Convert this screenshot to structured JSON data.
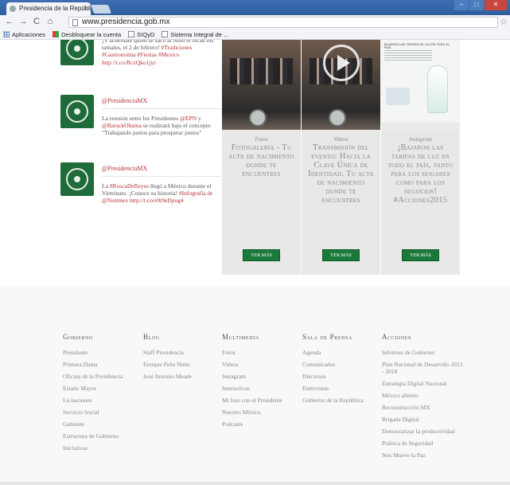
{
  "browser": {
    "tab_title": "Presidencia de la Repúblic",
    "tab_close": "×",
    "url": "www.presidencia.gob.mx",
    "bookmarks": [
      {
        "label": "Aplicaciones",
        "icon": "apps-grid-icon"
      },
      {
        "label": "Desbloquear la cuenta",
        "icon": "windows-icon"
      },
      {
        "label": "SIQyD",
        "icon": "page-icon"
      },
      {
        "label": "Sistema Integral de ...",
        "icon": "page-icon"
      }
    ]
  },
  "tweets": [
    {
      "handle": "",
      "text": "¡Y acuérdate quién se sacó al Niño te tocan los tamales, el 2 de febrero!",
      "tags": "#Tradiciones #Gastronomia #Fiestas #Mexico http://t.co/RczQko1jyr"
    },
    {
      "handle": "@PresidenciaMX",
      "text": "La reunión entre los Presidentes ",
      "mention1": "@EPN",
      "mid": " y ",
      "mention2": "@BarackObama",
      "rest": " se realizará bajo el concepto \"Trabajando juntos para prosperar juntos\""
    },
    {
      "handle": "@PresidenciaMX",
      "pre": "La ",
      "tag1": "#RoscaDeReyes",
      "text": " llegó a México durante el Virreinato. ¡Conoce su historia! ",
      "tags": "#Infografía de @Notimex http://t.co/e9t9eDpug4"
    }
  ],
  "cards": [
    {
      "category": "Fotos",
      "title": "Fotogalería - Tu acta de nacimiento donde te encuentres",
      "button": "VER MÁS"
    },
    {
      "category": "Videos",
      "title": "Transmisión del evento: Hacia la Clave Única de Identidad. Tu acta de nacimiento donde te encuentres",
      "button": "VER MÁS"
    },
    {
      "category": "Instagram",
      "title": "¡Bajaron las tarifas de luz en todo el país, tanto para los hogares como para los negocios! #Acciones2015",
      "button": "VER MÁS",
      "image_text": "BAJARON LAS TARIFAS DE LUZ EN TODO EL PAÍS"
    }
  ],
  "footer": {
    "columns": [
      {
        "heading": "Gobierno",
        "links": [
          "Presidente",
          "Primera Dama",
          "Oficina de la Presidencia",
          "Estado Mayor",
          "Licitaciones",
          "Servicio Social",
          "Gabinete",
          "Estructura de Gobierno",
          "Iniciativas"
        ]
      },
      {
        "heading": "Blog",
        "links": [
          "Staff Presidencia",
          "Enrique Peña Nieto",
          "José Antonio Meade"
        ]
      },
      {
        "heading": "Multimedia",
        "links": [
          "Fotos",
          "Videos",
          "Instagram",
          "Interactivas",
          "Mi foto con el Presidente",
          "Nuestro México",
          "Podcasts"
        ]
      },
      {
        "heading": "Sala de Prensa",
        "links": [
          "Agenda",
          "Comunicados",
          "Discursos",
          "Entrevistas",
          "Gobierno de la República"
        ]
      },
      {
        "heading": "Acciones",
        "links": [
          "Informes de Gobierno",
          "Plan Nacional de Desarrollo 2013 - 2018",
          "Estrategia Digital Nacional",
          "México abierto",
          "Reconstrucción MX",
          "Brigada Digital",
          "Democratizar la productividad",
          "Política de Seguridad",
          "Nos Mueve la Paz"
        ]
      }
    ]
  }
}
